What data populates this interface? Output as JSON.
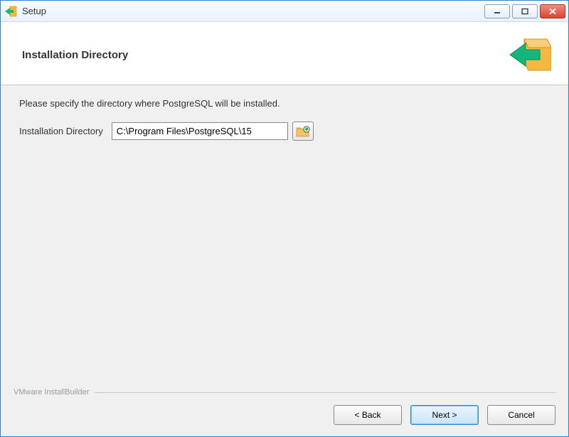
{
  "window": {
    "title": "Setup"
  },
  "header": {
    "pageTitle": "Installation Directory"
  },
  "content": {
    "instruction": "Please specify the directory where PostgreSQL will be installed.",
    "fieldLabel": "Installation Directory",
    "pathValue": "C:\\Program Files\\PostgreSQL\\15"
  },
  "footer": {
    "brand": "VMware InstallBuilder",
    "buttons": {
      "back": "< Back",
      "next": "Next >",
      "cancel": "Cancel"
    }
  },
  "icons": {
    "appIcon": "arrow-box-icon",
    "browseIcon": "folder-browse-icon"
  }
}
